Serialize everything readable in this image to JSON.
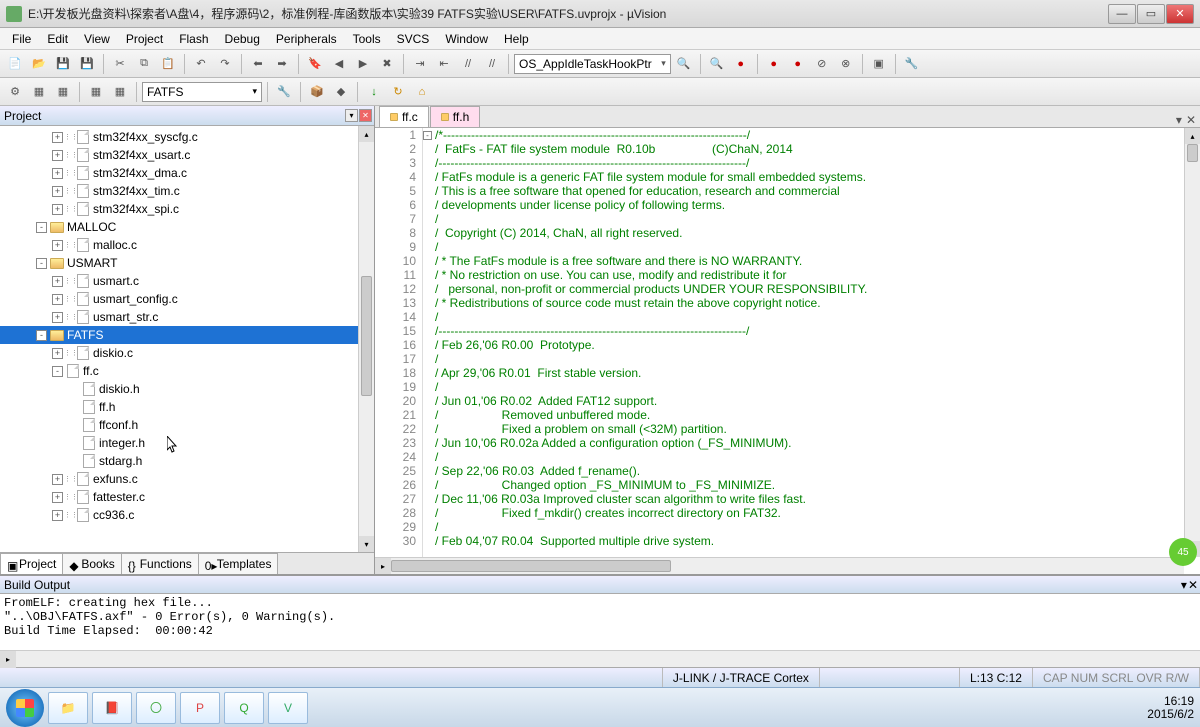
{
  "title": "E:\\开发板光盘资料\\探索者\\A盘\\4，程序源码\\2，标准例程-库函数版本\\实验39 FATFS实验\\USER\\FATFS.uvprojx - µVision",
  "menu": [
    "File",
    "Edit",
    "View",
    "Project",
    "Flash",
    "Debug",
    "Peripherals",
    "Tools",
    "SVCS",
    "Window",
    "Help"
  ],
  "toolbar1": {
    "combo": "OS_AppIdleTaskHookPtr"
  },
  "toolbar2": {
    "target": "FATFS"
  },
  "project": {
    "title": "Project",
    "tabs": [
      {
        "label": "Project",
        "icon": "proj",
        "active": true
      },
      {
        "label": "Books",
        "icon": "book",
        "active": false
      },
      {
        "label": "Functions",
        "icon": "func",
        "active": false
      },
      {
        "label": "Templates",
        "icon": "tmpl",
        "active": false
      }
    ],
    "items": [
      {
        "indent": 3,
        "toggle": "+",
        "dots": true,
        "icon": "file",
        "label": "stm32f4xx_syscfg.c"
      },
      {
        "indent": 3,
        "toggle": "+",
        "dots": true,
        "icon": "file",
        "label": "stm32f4xx_usart.c"
      },
      {
        "indent": 3,
        "toggle": "+",
        "dots": true,
        "icon": "file",
        "label": "stm32f4xx_dma.c"
      },
      {
        "indent": 3,
        "toggle": "+",
        "dots": true,
        "icon": "file",
        "label": "stm32f4xx_tim.c"
      },
      {
        "indent": 3,
        "toggle": "+",
        "dots": true,
        "icon": "file",
        "label": "stm32f4xx_spi.c"
      },
      {
        "indent": 2,
        "toggle": "-",
        "dots": false,
        "icon": "folder",
        "label": "MALLOC"
      },
      {
        "indent": 3,
        "toggle": "+",
        "dots": true,
        "icon": "file",
        "label": "malloc.c"
      },
      {
        "indent": 2,
        "toggle": "-",
        "dots": false,
        "icon": "folder",
        "label": "USMART"
      },
      {
        "indent": 3,
        "toggle": "+",
        "dots": true,
        "icon": "file",
        "label": "usmart.c"
      },
      {
        "indent": 3,
        "toggle": "+",
        "dots": true,
        "icon": "file",
        "label": "usmart_config.c"
      },
      {
        "indent": 3,
        "toggle": "+",
        "dots": true,
        "icon": "file",
        "label": "usmart_str.c"
      },
      {
        "indent": 2,
        "toggle": "-",
        "dots": false,
        "icon": "folder",
        "label": "FATFS",
        "selected": true
      },
      {
        "indent": 3,
        "toggle": "+",
        "dots": true,
        "icon": "file",
        "label": "diskio.c"
      },
      {
        "indent": 3,
        "toggle": "-",
        "dots": false,
        "icon": "file",
        "label": "ff.c"
      },
      {
        "indent": 4,
        "toggle": "",
        "dots": false,
        "icon": "file",
        "label": "diskio.h"
      },
      {
        "indent": 4,
        "toggle": "",
        "dots": false,
        "icon": "file",
        "label": "ff.h"
      },
      {
        "indent": 4,
        "toggle": "",
        "dots": false,
        "icon": "file",
        "label": "ffconf.h"
      },
      {
        "indent": 4,
        "toggle": "",
        "dots": false,
        "icon": "file",
        "label": "integer.h"
      },
      {
        "indent": 4,
        "toggle": "",
        "dots": false,
        "icon": "file",
        "label": "stdarg.h"
      },
      {
        "indent": 3,
        "toggle": "+",
        "dots": true,
        "icon": "file",
        "label": "exfuns.c"
      },
      {
        "indent": 3,
        "toggle": "+",
        "dots": true,
        "icon": "file",
        "label": "fattester.c"
      },
      {
        "indent": 3,
        "toggle": "+",
        "dots": true,
        "icon": "file",
        "label": "cc936.c"
      }
    ]
  },
  "editor": {
    "tabs": [
      {
        "label": "ff.c",
        "active": true
      },
      {
        "label": "ff.h",
        "active": false
      }
    ],
    "lines": [
      "/*----------------------------------------------------------------------------/",
      "/  FatFs - FAT file system module  R0.10b                 (C)ChaN, 2014",
      "/-----------------------------------------------------------------------------/",
      "/ FatFs module is a generic FAT file system module for small embedded systems.",
      "/ This is a free software that opened for education, research and commercial",
      "/ developments under license policy of following terms.",
      "/",
      "/  Copyright (C) 2014, ChaN, all right reserved.",
      "/",
      "/ * The FatFs module is a free software and there is NO WARRANTY.",
      "/ * No restriction on use. You can use, modify and redistribute it for",
      "/   personal, non-profit or commercial products UNDER YOUR RESPONSIBILITY.",
      "/ * Redistributions of source code must retain the above copyright notice.",
      "/",
      "/-----------------------------------------------------------------------------/",
      "/ Feb 26,'06 R0.00  Prototype.",
      "/",
      "/ Apr 29,'06 R0.01  First stable version.",
      "/",
      "/ Jun 01,'06 R0.02  Added FAT12 support.",
      "/                   Removed unbuffered mode.",
      "/                   Fixed a problem on small (<32M) partition.",
      "/ Jun 10,'06 R0.02a Added a configuration option (_FS_MINIMUM).",
      "/",
      "/ Sep 22,'06 R0.03  Added f_rename().",
      "/                   Changed option _FS_MINIMUM to _FS_MINIMIZE.",
      "/ Dec 11,'06 R0.03a Improved cluster scan algorithm to write files fast.",
      "/                   Fixed f_mkdir() creates incorrect directory on FAT32.",
      "/",
      "/ Feb 04,'07 R0.04  Supported multiple drive system."
    ]
  },
  "build": {
    "title": "Build Output",
    "lines": [
      "FromELF: creating hex file...",
      "\"..\\OBJ\\FATFS.axf\" - 0 Error(s), 0 Warning(s).",
      "Build Time Elapsed:  00:00:42"
    ]
  },
  "status": {
    "debugger": "J-LINK / J-TRACE Cortex",
    "cursor": "L:13 C:12",
    "indicators": "CAP  NUM  SCRL  OVR  R/W"
  },
  "tray": {
    "time": "16:19",
    "date": "2015/6/2"
  },
  "badge": "45"
}
